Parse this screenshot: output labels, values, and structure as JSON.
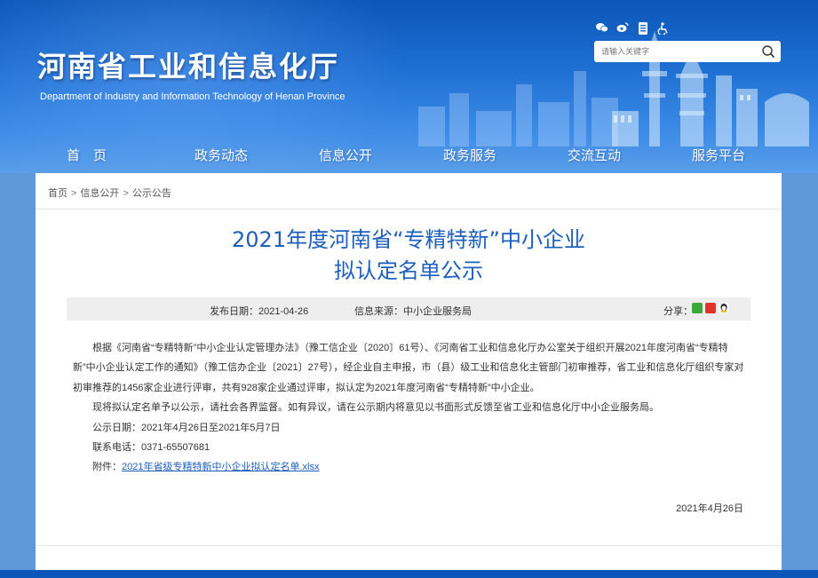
{
  "header": {
    "site_title": "河南省工业和信息化厅",
    "site_subtitle": "Department of Industry and Information Technology of Henan Province",
    "util_icons": [
      "wechat-icon",
      "weibo-icon",
      "mobile-app-icon",
      "accessibility-icon"
    ],
    "search": {
      "placeholder": "请输入关键字"
    },
    "nav": [
      "首　页",
      "政务动态",
      "信息公开",
      "政务服务",
      "交流互动",
      "服务平台"
    ],
    "colors": {
      "primary": "#0b56b8",
      "title_blue": "#1c5fbf"
    }
  },
  "breadcrumb": [
    "首页",
    "信息公开",
    "公示公告"
  ],
  "breadcrumb_sep": ">",
  "article": {
    "title_line1": "2021年度河南省“专精特新”中小企业",
    "title_line2": "拟认定名单公示",
    "publish_date": "发布日期：2021-04-26",
    "source": "信息来源：中小企业服务局",
    "share_label": "分享：",
    "share_icons": [
      "wechat-share-icon",
      "weibo-share-icon",
      "qq-share-icon"
    ],
    "paragraph1": "根据《河南省“专精特新”中小企业认定管理办法》（豫工信企业〔2020〕61号）、《河南省工业和信息化厅办公室关于组织开展2021年度河南省“专精特新”中小企业认定工作的通知》（豫工信办企业〔2021〕27号），经企业自主申报，市（县）级工业和信息化主管部门初审推荐，省工业和信息化厅组织专家对初审推荐的1456家企业进行评审，共有928家企业通过评审，拟认定为2021年度河南省“专精特新”中小企业。",
    "paragraph2": "现将拟认定名单予以公示，请社会各界监督。如有异议，请在公示期内将意见以书面形式反馈至省工业和信息化厅中小企业服务局。",
    "period": "公示日期：2021年4月26日至2021年5月7日",
    "phone": "联系电话：0371-65507681",
    "attachment_label": "附件：",
    "attachment_link": "2021年省级专精特新中小企业拟认定名单.xlsx",
    "sign_date": "2021年4月26日"
  }
}
